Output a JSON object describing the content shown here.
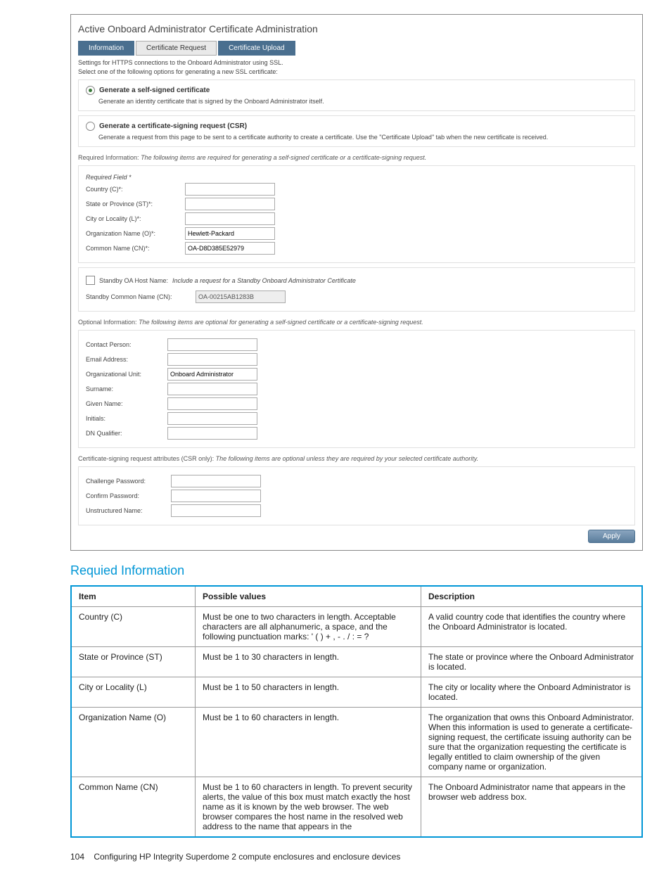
{
  "title": "Active Onboard Administrator Certificate Administration",
  "tabs": {
    "t1": "Information",
    "t2": "Certificate Request",
    "t3": "Certificate Upload"
  },
  "settings_line": "Settings for HTTPS connections to the Onboard Administrator using SSL.",
  "select_line": "Select one of the following options for generating a new SSL certificate:",
  "opt1": {
    "label": "Generate a self-signed certificate",
    "desc": "Generate an identity certificate that is signed by the Onboard Administrator itself."
  },
  "opt2": {
    "label": "Generate a certificate-signing request (CSR)",
    "desc": "Generate a request from this page to be sent to a certificate authority to create a certificate. Use the \"Certificate Upload\" tab when the new certificate is received."
  },
  "req_info_label": "Required Information:",
  "req_info_text": "The following items are required for generating a self-signed certificate or a certificate-signing request.",
  "req_field_note": "Required Field *",
  "fields": {
    "country": "Country (C)*:",
    "state": "State or Province (ST)*:",
    "city": "City or Locality (L)*:",
    "org": "Organization Name (O)*:",
    "cn": "Common Name (CN)*:",
    "org_val": "Hewlett-Packard",
    "cn_val": "OA-D8D385E52979"
  },
  "standby": {
    "chk_label": "Standby OA Host Name:",
    "chk_text": "Include a request for a Standby Onboard Administrator Certificate",
    "cn_label": "Standby Common Name (CN):",
    "cn_val": "OA-00215AB1283B"
  },
  "opt_info_label": "Optional Information:",
  "opt_info_text": "The following items are optional for generating a self-signed certificate or a certificate-signing request.",
  "optfields": {
    "contact": "Contact Person:",
    "email": "Email Address:",
    "ou": "Organizational Unit:",
    "ou_val": "Onboard Administrator",
    "surname": "Surname:",
    "given": "Given Name:",
    "initials": "Initials:",
    "dn": "DN Qualifier:"
  },
  "csr_attr_label": "Certificate-signing request attributes (CSR only):",
  "csr_attr_text": "The following items are optional unless they are required by your selected certificate authority.",
  "csrfields": {
    "challenge": "Challenge Password:",
    "confirm": "Confirm Password:",
    "unstructured": "Unstructured Name:"
  },
  "apply": "Apply",
  "table_header": "Requied Information",
  "th": {
    "item": "Item",
    "pv": "Possible values",
    "desc": "Description"
  },
  "rows": [
    {
      "item": "Country (C)",
      "pv": "Must be one to two characters in length. Acceptable characters are all alphanumeric, a space, and the following punctuation marks: ' ( ) + , - . / : = ?",
      "desc": "A valid country code that identifies the country where the Onboard Administrator is located."
    },
    {
      "item": "State or Province (ST)",
      "pv": "Must be 1 to 30 characters in length.",
      "desc": "The state or province where the Onboard Administrator is located."
    },
    {
      "item": "City or Locality (L)",
      "pv": "Must be 1 to 50 characters in length.",
      "desc": "The city or locality where the Onboard Administrator is located."
    },
    {
      "item": "Organization Name (O)",
      "pv": "Must be 1 to 60 characters in length.",
      "desc": "The organization that owns this Onboard Administrator. When this information is used to generate a certificate-signing request, the certificate issuing authority can be sure that the organization requesting the certificate is legally entitled to claim ownership of the given company name or organization."
    },
    {
      "item": "Common Name (CN)",
      "pv": "Must be 1 to 60 characters in length. To prevent security alerts, the value of this box must match exactly the host name as it is known by the web browser. The web browser compares the host name in the resolved web address to the name that appears in the",
      "desc": "The Onboard Administrator name that appears in the browser web address box."
    }
  ],
  "footer": {
    "page": "104",
    "text": "Configuring HP Integrity Superdome 2 compute enclosures and enclosure devices"
  }
}
